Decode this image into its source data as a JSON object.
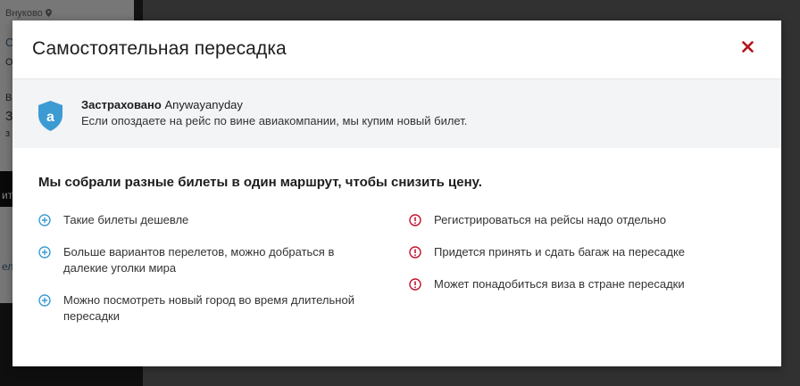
{
  "background": {
    "location_label": "Внуково",
    "fragment_1": "С",
    "fragment_2": "О",
    "fragment_3": "В",
    "fragment_4": "3",
    "fragment_5": "з",
    "fragment_6": "ит",
    "fragment_7": "ел"
  },
  "modal": {
    "title": "Самостоятельная пересадка",
    "close_label": "×",
    "insurance": {
      "badge_letter": "a",
      "title_bold": "Застраховано",
      "title_brand": "Anywayanyday",
      "text": "Если опоздаете на рейс по вине авиакомпании, мы купим новый билет."
    },
    "intro": "Мы собрали разные билеты в один маршрут, чтобы снизить цену.",
    "pros": [
      {
        "text": "Такие билеты дешевле"
      },
      {
        "text": "Больше вариантов перелетов, можно добраться в далекие уголки мира"
      },
      {
        "text": "Можно посмотреть новый город во время длительной пересадки"
      }
    ],
    "cons": [
      {
        "text": "Регистрироваться на рейсы надо отдельно"
      },
      {
        "text": "Придется принять и сдать багаж на пересадке"
      },
      {
        "text": "Может понадобиться виза в стране пересадки"
      }
    ]
  },
  "colors": {
    "accent_blue": "#3d9bd4",
    "warning_red": "#c8102e",
    "close_red": "#b3121b"
  }
}
